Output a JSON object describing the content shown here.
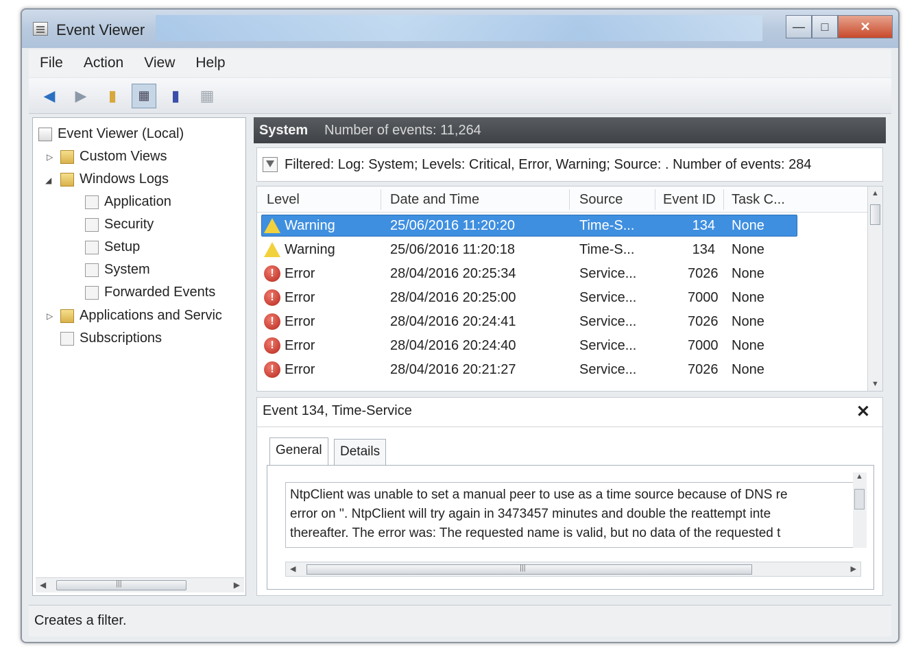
{
  "window": {
    "title": "Event Viewer"
  },
  "menu": {
    "items": [
      "File",
      "Action",
      "View",
      "Help"
    ]
  },
  "tree": {
    "root": "Event Viewer (Local)",
    "custom_views": "Custom Views",
    "windows_logs": "Windows Logs",
    "application": "Application",
    "security": "Security",
    "setup": "Setup",
    "system": "System",
    "forwarded_events": "Forwarded Events",
    "apps_services": "Applications and Servic",
    "subscriptions": "Subscriptions"
  },
  "log_header": {
    "title": "System",
    "count": "Number of events: 11,264"
  },
  "filter": {
    "text": "Filtered: Log: System; Levels: Critical, Error, Warning; Source: . Number of events: 284"
  },
  "grid": {
    "columns": [
      "Level",
      "Date and Time",
      "Source",
      "Event ID",
      "Task C..."
    ],
    "rows": [
      {
        "level": "Warning",
        "level_type": "warning",
        "datetime": "25/06/2016 11:20:20",
        "source": "Time-S...",
        "event_id": "134",
        "task": "None",
        "selected": true
      },
      {
        "level": "Warning",
        "level_type": "warning",
        "datetime": "25/06/2016 11:20:18",
        "source": "Time-S...",
        "event_id": "134",
        "task": "None",
        "selected": false
      },
      {
        "level": "Error",
        "level_type": "error",
        "datetime": "28/04/2016 20:25:34",
        "source": "Service...",
        "event_id": "7026",
        "task": "None",
        "selected": false
      },
      {
        "level": "Error",
        "level_type": "error",
        "datetime": "28/04/2016 20:25:00",
        "source": "Service...",
        "event_id": "7000",
        "task": "None",
        "selected": false
      },
      {
        "level": "Error",
        "level_type": "error",
        "datetime": "28/04/2016 20:24:41",
        "source": "Service...",
        "event_id": "7026",
        "task": "None",
        "selected": false
      },
      {
        "level": "Error",
        "level_type": "error",
        "datetime": "28/04/2016 20:24:40",
        "source": "Service...",
        "event_id": "7000",
        "task": "None",
        "selected": false
      },
      {
        "level": "Error",
        "level_type": "error",
        "datetime": "28/04/2016 20:21:27",
        "source": "Service...",
        "event_id": "7026",
        "task": "None",
        "selected": false
      }
    ]
  },
  "detail": {
    "title": "Event 134, Time-Service",
    "tabs": [
      "General",
      "Details"
    ],
    "message_lines": [
      "NtpClient was unable to set a manual peer to use as a time source because of DNS re",
      "error on ''. NtpClient will try again in 3473457 minutes and double the reattempt inte",
      "thereafter. The error was: The requested name is valid, but no data of the requested t"
    ]
  },
  "status": {
    "text": "Creates a filter."
  },
  "colors": {
    "selection": "#3f8fe0",
    "header_bar": "#4a4e52",
    "warning_icon": "#f2d23c",
    "error_icon": "#c0392b"
  }
}
